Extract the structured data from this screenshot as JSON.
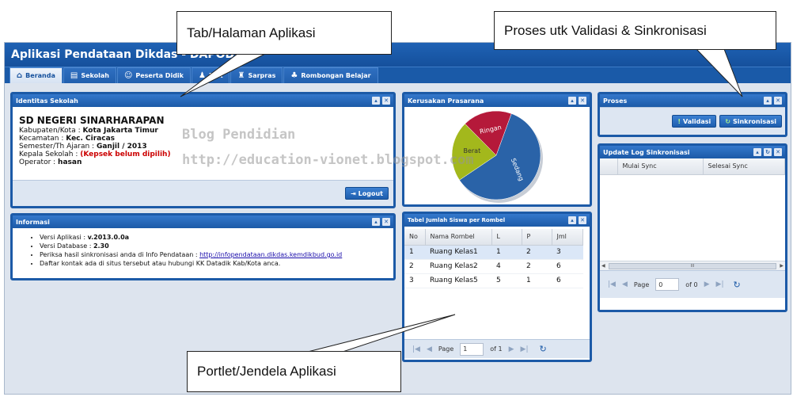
{
  "app": {
    "title": "Aplikasi Pendataan Dikdas - DAPODIK"
  },
  "tabs": [
    {
      "label": "Beranda",
      "icon": "home-icon",
      "active": true
    },
    {
      "label": "Sekolah",
      "icon": "school-icon"
    },
    {
      "label": "Peserta Didik",
      "icon": "student-icon"
    },
    {
      "label": "PTK",
      "icon": "teacher-icon"
    },
    {
      "label": "Sarpras",
      "icon": "sarpras-icon"
    },
    {
      "label": "Rombongan Belajar",
      "icon": "group-icon"
    }
  ],
  "identitas": {
    "title": "Identitas Sekolah",
    "school_name": "SD NEGERI SINARHARAPAN",
    "kab_label": "Kabupaten/Kota : ",
    "kab_value": "Kota Jakarta Timur",
    "kec_label": "Kecamatan : ",
    "kec_value": "Kec. Ciracas",
    "sem_label": "Semester/Th Ajaran : ",
    "sem_value": "Ganjil / 2013",
    "kepsek_label": "Kepala Sekolah : ",
    "kepsek_value": "(Kepsek belum dipilih)",
    "op_label": "Operator : ",
    "op_value": "hasan",
    "logout": "Logout"
  },
  "informasi": {
    "title": "Informasi",
    "items": [
      {
        "prefix": "Versi Aplikasi : ",
        "value": "v.2013.0.0a"
      },
      {
        "prefix": "Versi Database : ",
        "value": "2.30"
      },
      {
        "prefix": "Periksa hasil sinkronisasi anda di Info Pendataan : ",
        "link": "http://infopendataan.dikdas.kemdikbud.go.id"
      },
      {
        "prefix": "Daftar kontak ada di situs tersebut atau hubungi KK Datadik Kab/Kota anca."
      }
    ]
  },
  "kerusakan": {
    "title": "Kerusakan Prasarana"
  },
  "chart_data": {
    "type": "pie",
    "title": "Kerusakan Prasarana",
    "categories": [
      "Sedang",
      "Berat",
      "Ringan"
    ],
    "values": [
      60,
      22,
      18
    ],
    "colors": [
      "#2a63a8",
      "#a3b81c",
      "#b5193a"
    ]
  },
  "tabel": {
    "title": "Tabel Jumlah Siswa per Rombel",
    "headers": [
      "No",
      "Nama Rombel",
      "L",
      "P",
      "Jml"
    ],
    "rows": [
      [
        "1",
        "Ruang Kelas1",
        "1",
        "2",
        "3"
      ],
      [
        "2",
        "Ruang Kelas2",
        "4",
        "2",
        "6"
      ],
      [
        "3",
        "Ruang Kelas5",
        "5",
        "1",
        "6"
      ]
    ],
    "page_label": "Page",
    "page_value": "1",
    "of_label": "of 1"
  },
  "proses": {
    "title": "Proses",
    "validasi": "Validasi",
    "sinkronisasi": "Sinkronisasi"
  },
  "log": {
    "title": "Update Log Sinkronisasi",
    "headers": [
      "Mulai Sync",
      "Selesai Sync"
    ],
    "scroll_mid": "III",
    "page_label": "Page",
    "page_value": "0",
    "of_label": "of 0"
  },
  "callouts": {
    "tabs": "Tab/Halaman Aplikasi",
    "proses": "Proses utk Validasi & Sinkronisasi",
    "portlet": "Portlet/Jendela Aplikasi"
  },
  "watermark": {
    "line1": "Blog Pendidian",
    "line2": "http://education-vionet.blogspot.com"
  },
  "colors": {
    "header": "#1c5aa7",
    "accent": "#2a63a8",
    "warning": "#cc0000",
    "link": "#1a0dab"
  }
}
